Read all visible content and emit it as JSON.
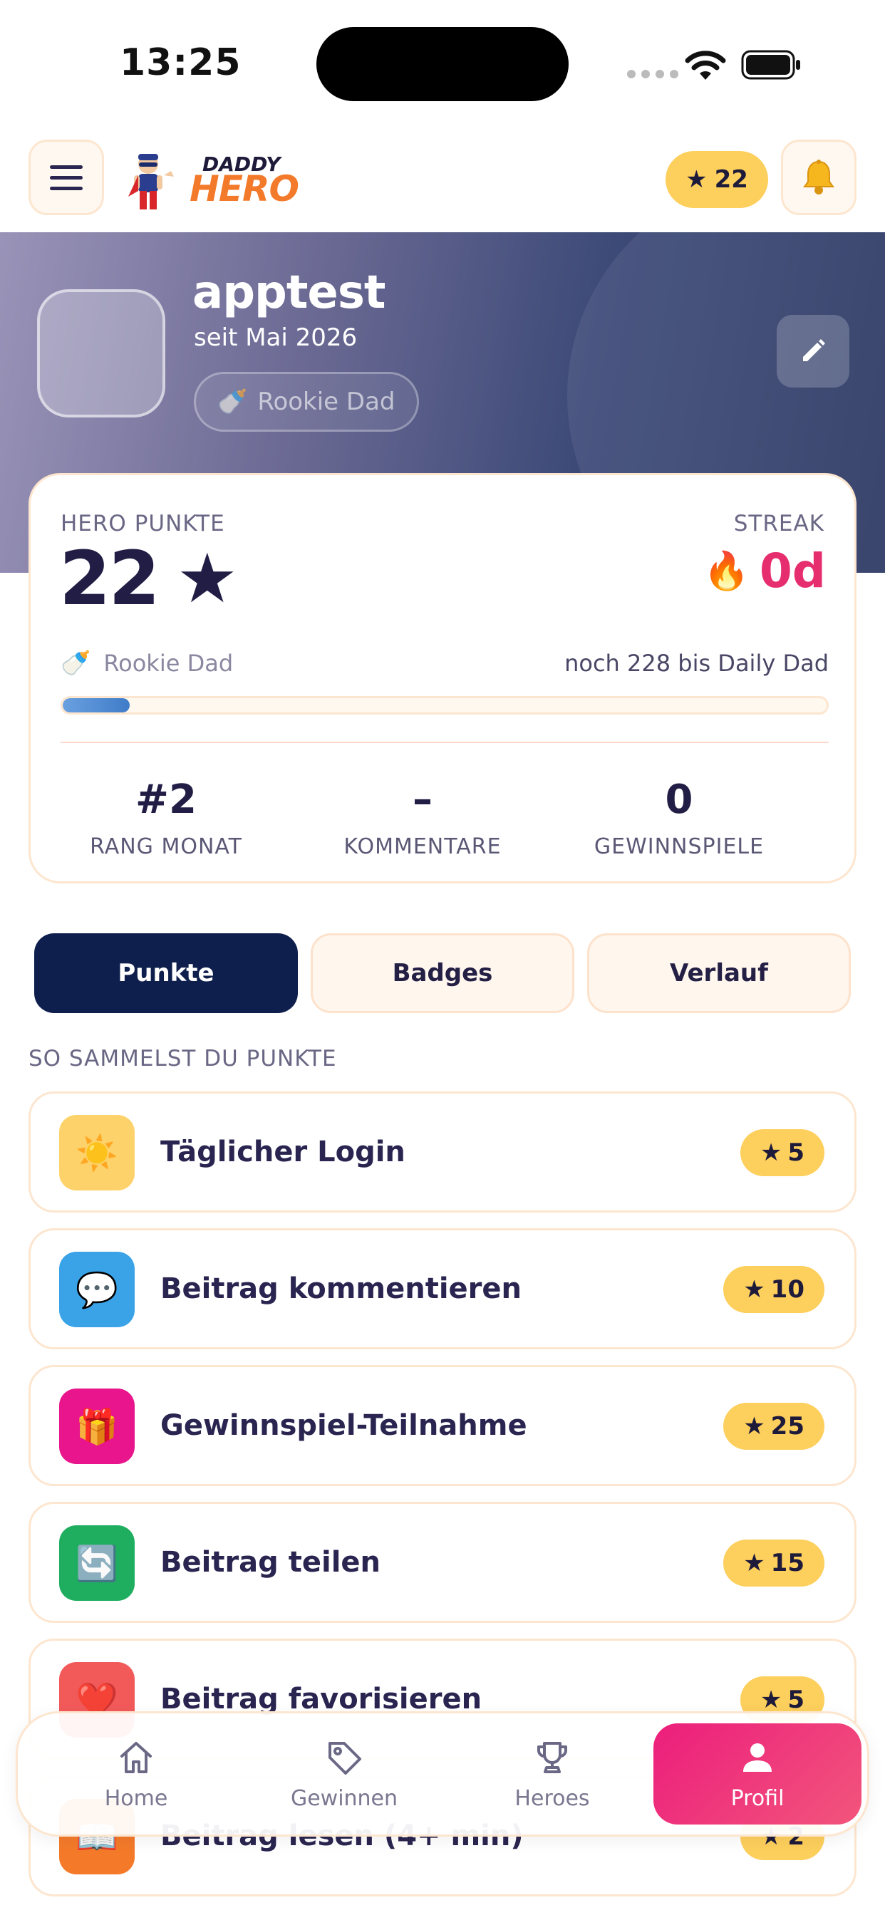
{
  "status_bar": {
    "time": "13:25"
  },
  "header": {
    "logo_top": "DADDY",
    "logo_bottom": "HERO",
    "points_star": "★",
    "points_value": "22"
  },
  "profile": {
    "username": "apptest",
    "member_since": "seit Mai 2026",
    "rank_chip_icon": "🍼",
    "rank_chip_label": "Rookie Dad"
  },
  "points_card": {
    "hero_label": "HERO PUNKTE",
    "hero_points": "22",
    "hero_star": "★",
    "streak_label": "STREAK",
    "streak_icon": "🔥",
    "streak_value": "0d",
    "level_icon": "🍼",
    "level_name": "Rookie Dad",
    "level_remaining": "noch 228 bis Daily Dad",
    "progress_fraction": 0.088,
    "stats": [
      {
        "value": "#2",
        "label": "RANG MONAT"
      },
      {
        "value": "–",
        "label": "KOMMENTARE"
      },
      {
        "value": "0",
        "label": "GEWINNSPIELE"
      }
    ]
  },
  "tabs": [
    {
      "label": "Punkte",
      "active": true
    },
    {
      "label": "Badges",
      "active": false
    },
    {
      "label": "Verlauf",
      "active": false
    }
  ],
  "section_title": "SO SAMMELST DU PUNKTE",
  "tasks": [
    {
      "icon": "☀️",
      "icon_name": "sun-icon",
      "color": "#fdd26a",
      "label": "Täglicher Login",
      "points": "5"
    },
    {
      "icon": "💬",
      "icon_name": "speech-bubble-icon",
      "color": "#3aa3e8",
      "label": "Beitrag kommentieren",
      "points": "10"
    },
    {
      "icon": "🎁",
      "icon_name": "gift-icon",
      "color": "#e8158c",
      "label": "Gewinnspiel-Teilnahme",
      "points": "25"
    },
    {
      "icon": "🔄",
      "icon_name": "share-icon",
      "color": "#1fae5f",
      "label": "Beitrag teilen",
      "points": "15"
    },
    {
      "icon": "❤️",
      "icon_name": "heart-icon",
      "color": "#f25a5a",
      "label": "Beitrag favorisieren",
      "points": "5"
    },
    {
      "icon": "📖",
      "icon_name": "book-icon",
      "color": "#f47a2a",
      "label": "Beitrag lesen (4+ min)",
      "points": "2"
    }
  ],
  "task_star": "★",
  "bottom_nav": [
    {
      "label": "Home",
      "icon": "home-icon"
    },
    {
      "label": "Gewinnen",
      "icon": "tag-icon"
    },
    {
      "label": "Heroes",
      "icon": "trophy-icon"
    },
    {
      "label": "Profil",
      "icon": "person-icon",
      "active": true
    }
  ]
}
